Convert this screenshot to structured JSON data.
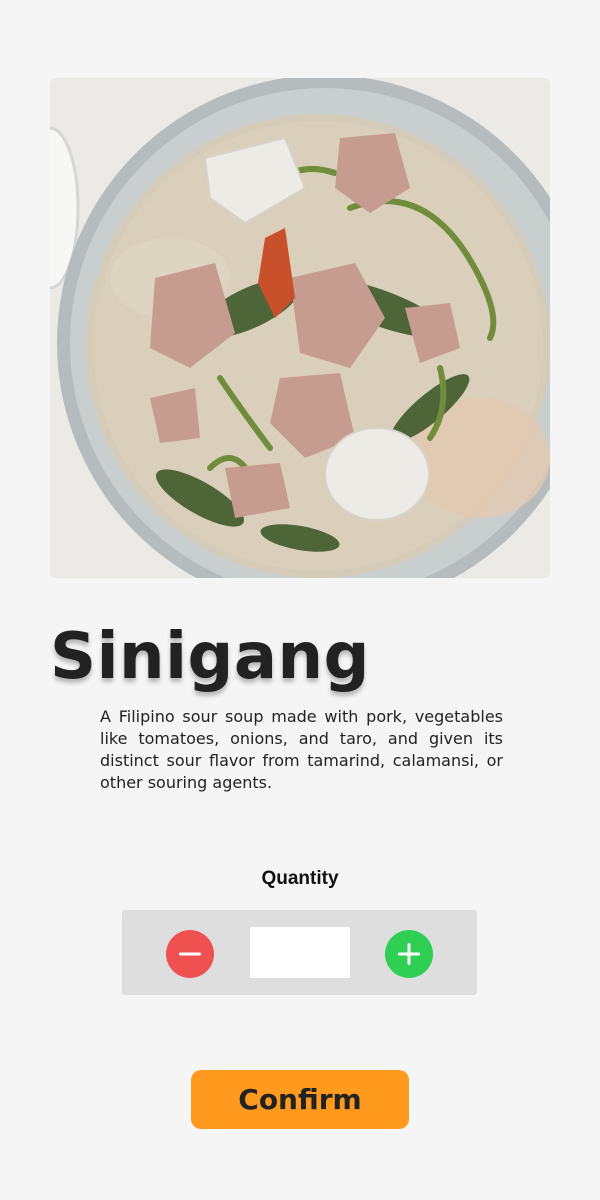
{
  "dish": {
    "image_alt": "Bowl of sinigang soup",
    "title": "Sinigang",
    "description": "A Filipino sour soup made with pork, vegetables like tomatoes, onions, and taro, and given its distinct sour flavor from tamarind, calamansi, or other souring agents."
  },
  "quantity": {
    "label": "Quantity",
    "value": "",
    "decrement_icon": "minus-icon",
    "increment_icon": "plus-icon"
  },
  "actions": {
    "confirm_label": "Confirm"
  },
  "colors": {
    "background": "#f5f5f5",
    "decrement": "#ef5151",
    "increment": "#2fcf54",
    "confirm": "#ff9a1e",
    "stepper_bg": "#dedede"
  }
}
